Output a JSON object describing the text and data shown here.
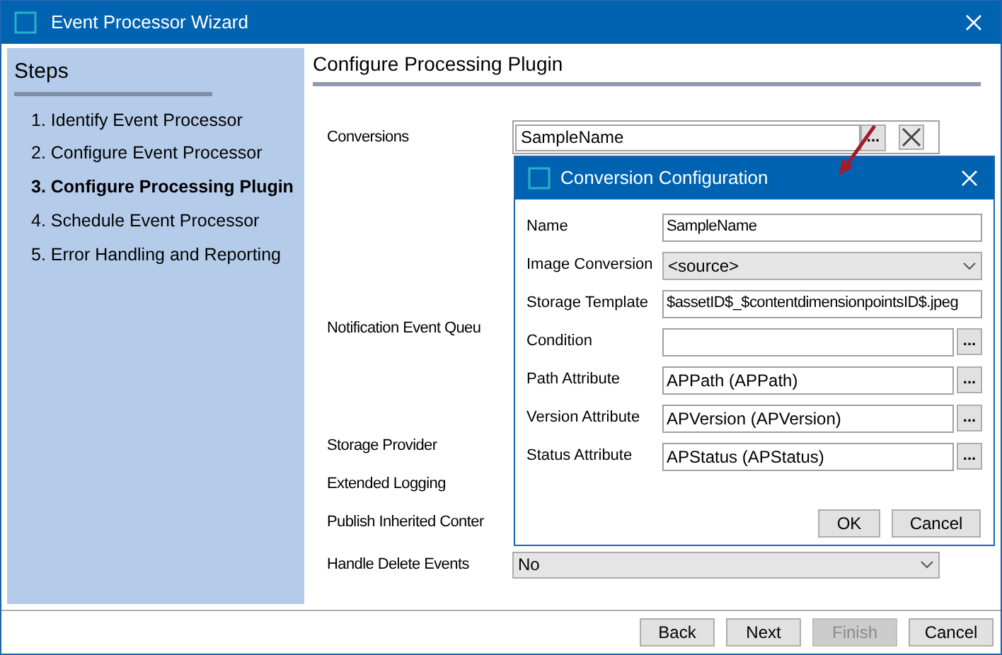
{
  "window": {
    "title": "Event Processor Wizard"
  },
  "steps": {
    "heading": "Steps",
    "items": [
      {
        "label": "1. Identify Event Processor",
        "selected": false
      },
      {
        "label": "2. Configure Event Processor",
        "selected": false
      },
      {
        "label": "3. Configure Processing Plugin",
        "selected": true
      },
      {
        "label": "4. Schedule Event Processor",
        "selected": false
      },
      {
        "label": "5. Error Handling and Reporting",
        "selected": false
      }
    ]
  },
  "page": {
    "heading": "Configure Processing Plugin",
    "fields": [
      {
        "label": "Conversions",
        "kind": "list",
        "value": "SampleName",
        "button": "..."
      },
      {
        "label": "Notification Event Queu",
        "kind": "label"
      },
      {
        "label": "Storage Provider",
        "kind": "label"
      },
      {
        "label": "Extended Logging",
        "kind": "label"
      },
      {
        "label": "Publish Inherited Conter",
        "kind": "label"
      },
      {
        "label": "Handle Delete Events",
        "kind": "dropdown",
        "value": "No"
      }
    ]
  },
  "dialog": {
    "title": "Conversion Configuration",
    "fields": [
      {
        "label": "Name",
        "kind": "text",
        "value": "SampleName"
      },
      {
        "label": "Image Conversion",
        "kind": "dropdown",
        "value": "<source>"
      },
      {
        "label": "Storage Template",
        "kind": "text",
        "value": "$assetID$_$contentdimensionpointsID$.jpeg"
      },
      {
        "label": "Condition",
        "kind": "picker",
        "button": "..."
      },
      {
        "label": "Path Attribute",
        "kind": "picker",
        "value": "APPath (APPath)",
        "button": "..."
      },
      {
        "label": "Version Attribute",
        "kind": "picker",
        "value": "APVersion (APVersion)",
        "button": "..."
      },
      {
        "label": "Status Attribute",
        "kind": "picker",
        "value": "APStatus (APStatus)",
        "button": "..."
      }
    ],
    "buttons": [
      {
        "label": "OK"
      },
      {
        "label": "Cancel"
      }
    ]
  },
  "footer": {
    "buttons": [
      {
        "label": "Back",
        "disabled": false
      },
      {
        "label": "Next",
        "disabled": false
      },
      {
        "label": "Finish",
        "disabled": true
      },
      {
        "label": "Cancel",
        "disabled": false
      }
    ]
  }
}
